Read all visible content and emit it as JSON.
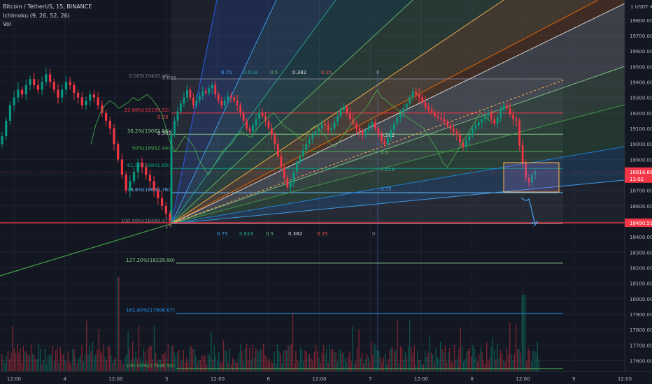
{
  "header": {
    "symbol": "Bitcoin / TetherUS, 15, BINANCE",
    "ichimoku": "Ichimoku (9, 26, 52, 26)",
    "volume": "Vol"
  },
  "currency_label": "1 USDT ▾",
  "chart_data": {
    "type": "candlestick",
    "title": "Bitcoin / TetherUS, 15, BINANCE",
    "yaxis": {
      "side": "right",
      "range": [
        17530,
        19930
      ],
      "ticks": [
        19800,
        19700,
        19600,
        19500,
        19400,
        19300,
        19200,
        19100,
        19000,
        18900,
        18800,
        18700,
        18600,
        18500,
        18400,
        18300,
        18200,
        18100,
        18000,
        17900,
        17800,
        17700,
        17600
      ]
    },
    "xaxis": {
      "ticks": [
        "12:00",
        "4",
        "12:00",
        "5",
        "12:00",
        "6",
        "12:00",
        "7",
        "12:00",
        "8",
        "12:00",
        "9",
        "12:00"
      ]
    },
    "current_price": {
      "label": "18816.66",
      "countdown": "13:02"
    },
    "horizontal_line": {
      "label": "18490.59",
      "value": 18490.59,
      "color": "#f23645"
    },
    "fib_retracement": [
      {
        "label": "0.005(19420.46)",
        "value": 19420.46,
        "color": "#787b86"
      },
      {
        "label": "23.60%(19199.52)",
        "value": 19199.52,
        "color": "#f23645"
      },
      {
        "label": "38.2%(19062.88)",
        "value": 19062.88,
        "color": "#81c784"
      },
      {
        "label": "50%(18952.44)",
        "value": 18952.44,
        "color": "#4caf50"
      },
      {
        "label": "61.8%(18841.89)",
        "value": 18841.89,
        "color": "#089981"
      },
      {
        "label": "78.6%(18684.76)",
        "value": 18684.76,
        "color": "#64b5f6"
      },
      {
        "label": "100.00%(18484.47)",
        "value": 18484.47,
        "color": "#787b86"
      },
      {
        "label": "127.20%(18229.90)",
        "value": 18229.9,
        "color": "#81c784"
      },
      {
        "label": "161.80%(17906.07)",
        "value": 17906.07,
        "color": "#2196f3"
      },
      {
        "label": "230.00%(17548.55)",
        "value": 17548.55,
        "color": "#4caf50"
      }
    ],
    "gann_fan": {
      "labels_top": [
        "0.75",
        "0.618",
        "0.5",
        "0.382",
        "0.25",
        "0"
      ],
      "labels_bottom": [
        "0.75",
        "0.618",
        "0.5",
        "0.382",
        "0.25",
        "0"
      ],
      "labels_right": [
        "0.382",
        "0.5",
        "0.618",
        "0.75"
      ],
      "left_inner_labels": [
        "0.25",
        "0.382"
      ]
    },
    "box_label": "0.005",
    "bottom_left_label": "1",
    "candles_close": [
      19060,
      19150,
      19210,
      19260,
      19300,
      19350,
      19300,
      19250,
      19280,
      19310,
      19340,
      19330,
      19360,
      19380,
      19320,
      19280,
      19250,
      19280,
      19310,
      19300,
      19280,
      19250,
      19200,
      19150,
      19100,
      19080,
      19120,
      19160,
      19200,
      19180,
      19150,
      19100,
      19060,
      19000,
      18920,
      18850,
      18780,
      18720,
      18750,
      18820,
      18880,
      18920,
      18960,
      19000,
      19030,
      19060,
      19080,
      19100,
      19130,
      19120,
      19090,
      19100,
      19140,
      19180,
      19220,
      19240,
      19200,
      19160,
      19130,
      19100,
      19080,
      19060,
      19090,
      19120,
      19140,
      19100,
      19060,
      19020,
      19000,
      19040,
      19090,
      19130,
      19170,
      19200,
      19230,
      19260,
      19300,
      19340,
      19320,
      19300,
      19270,
      19240,
      19220,
      19200,
      19180,
      19170,
      19160,
      19140,
      19120,
      19100,
      19080,
      19060,
      19010,
      18980,
      19020,
      19060,
      19100,
      19120,
      19140,
      19160,
      19180,
      19200,
      19160,
      19130,
      19170,
      19220,
      19250,
      19230,
      19190,
      19160,
      19150,
      18990,
      18880,
      18780,
      18750,
      18800,
      18820
    ],
    "ichimoku_lagging": [
      19000,
      19120,
      19200,
      19250,
      19280,
      19260,
      19230,
      19250,
      19270,
      19300,
      19280,
      19300,
      19320,
      19290,
      19250,
      19200,
      19100,
      19000,
      18950,
      19000,
      19050,
      19020,
      18980,
      18900,
      18850,
      18800,
      18850,
      18900,
      18950,
      18980,
      19000,
      19050,
      19080,
      19060,
      19040,
      19080,
      19120,
      19150,
      19180,
      19200,
      19160,
      19120,
      19100,
      19080,
      19050,
      19020,
      19050,
      19100,
      19120,
      19080,
      19050,
      19000,
      18980,
      19020,
      19060,
      19110,
      19150,
      19180,
      19210,
      19250,
      19300,
      19350,
      19300,
      19280,
      19250,
      19230,
      19200,
      19180,
      19160,
      19140,
      19120,
      19100,
      19050,
      19000,
      18950,
      18880,
      18850,
      18900,
      18950,
      19000,
      19050,
      19100,
      19150,
      19200,
      19180,
      19150
    ]
  }
}
